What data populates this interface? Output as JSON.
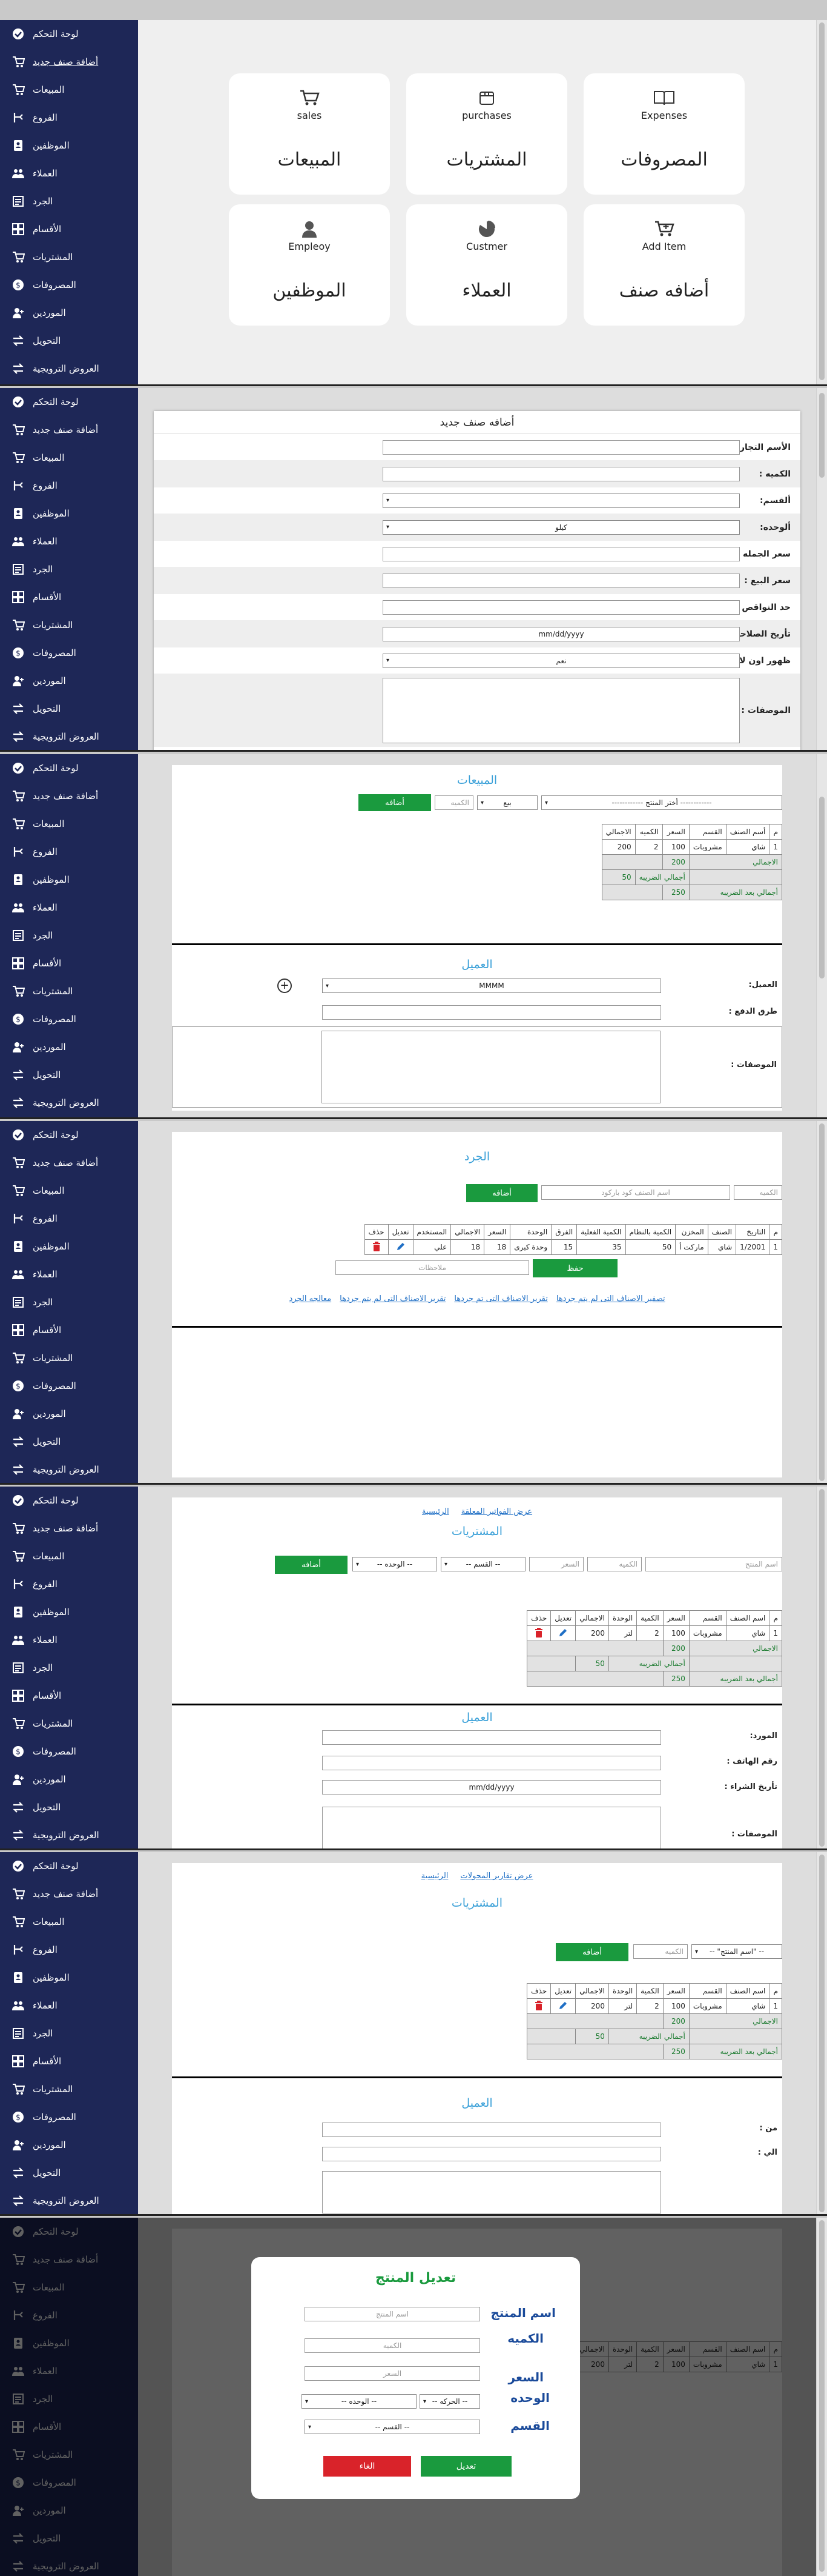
{
  "sidebar": {
    "items": [
      {
        "label": "لوحة التحكم",
        "icon": "dashboard-icon"
      },
      {
        "label": "أضافة صنف جديد",
        "icon": "add-item-icon"
      },
      {
        "label": "المبيعات",
        "icon": "cart-icon"
      },
      {
        "label": "الفروع",
        "icon": "branch-icon"
      },
      {
        "label": "الموظفين",
        "icon": "employee-icon"
      },
      {
        "label": "العملاء",
        "icon": "customers-icon"
      },
      {
        "label": "الجرد",
        "icon": "inventory-icon"
      },
      {
        "label": "الأقسام",
        "icon": "departments-icon"
      },
      {
        "label": "المشتريات",
        "icon": "cart-icon"
      },
      {
        "label": "المصروفات",
        "icon": "expenses-icon"
      },
      {
        "label": "الموردين",
        "icon": "suppliers-icon"
      },
      {
        "label": "التحويل",
        "icon": "transfer-icon"
      },
      {
        "label": "العروض الترويجية",
        "icon": "offers-icon"
      }
    ]
  },
  "dashboard": {
    "cards": [
      {
        "en": "Expenses",
        "ar": "المصروفات",
        "icon": "book-icon"
      },
      {
        "en": "purchases",
        "ar": "المشتريات",
        "icon": "box-icon"
      },
      {
        "en": "sales",
        "ar": "المبيعات",
        "icon": "cart-icon"
      },
      {
        "en": "Add Item",
        "ar": "أضافه صنف",
        "icon": "cart-plus-icon"
      },
      {
        "en": "Custmer",
        "ar": "العملاء",
        "icon": "pie-icon"
      },
      {
        "en": "Empleoy",
        "ar": "الموظفين",
        "icon": "user-icon"
      }
    ]
  },
  "add_item": {
    "title": "أضافه صنف جديد",
    "fields": [
      {
        "label": "الأسم التجاري:",
        "type": "text",
        "value": ""
      },
      {
        "label": "الكميه :",
        "type": "text",
        "value": ""
      },
      {
        "label": "ألقسم:",
        "type": "select",
        "value": ""
      },
      {
        "label": "ألوحده:",
        "type": "select",
        "value": "كيلو"
      },
      {
        "label": "سعر الجمله :",
        "type": "text",
        "value": ""
      },
      {
        "label": "سعر البيع :",
        "type": "text",
        "value": ""
      },
      {
        "label": "حد النواقص :",
        "type": "text",
        "value": ""
      },
      {
        "label": "تأريخ الصلاحيه :",
        "type": "date",
        "value": "mm/dd/yyyy"
      },
      {
        "label": "ظهور اون لاين:",
        "type": "select",
        "value": "نعم"
      },
      {
        "label": "الموصفات :",
        "type": "textarea",
        "value": ""
      }
    ]
  },
  "sales": {
    "title": "المبيعات",
    "product_select": "------------ أختر المنتج ------------",
    "type_select": "بيع",
    "qty_placeholder": "الكميه",
    "add_label": "أضافه",
    "headers": [
      "م",
      "أسم الصنف",
      "القسم",
      "السعر",
      "الكميه",
      "الاجمالي"
    ],
    "rows": [
      [
        "1",
        "شاي",
        "مشروبات",
        "100",
        "2",
        "200"
      ]
    ],
    "total_label": "الاجمالي",
    "total_value": "200",
    "tax_label": "أجمالي الضريبه",
    "tax_value": "50",
    "after_tax_label": "أجمالي بعد الضريبه",
    "after_tax_value": "250",
    "client_title": "العميل",
    "client_label": "العميل:",
    "client_value": "MMMM",
    "payment_label": "طرق الدفع :",
    "notes_label": "الموصفات :"
  },
  "inventory": {
    "title": "الجرد",
    "qty_placeholder": "الكميه",
    "search_placeholder": "اسم الصنف كود باركود",
    "add_label": "أضافه",
    "headers": [
      "م",
      "التاريخ",
      "الصنف",
      "المخزن",
      "الكمية بالنظام",
      "الكمية الفعلية",
      "الفرق",
      "الوحدة",
      "السعر",
      "الاجمالي",
      "المستخدم",
      "تعديل",
      "حذف"
    ],
    "rows": [
      [
        "1",
        "1/2001",
        "شاي",
        "ماركت أ",
        "50",
        "35",
        "15",
        "وحدة كبرى",
        "18",
        "18",
        "علي"
      ]
    ],
    "notes_placeholder": "ملاحظات",
    "save_label": "حفظ",
    "links": [
      "تصفير الاصناف التى لم يتم جردها",
      "تقرير الاصناف التى تم جردها",
      "تقرير الاصناف التى لم يتم جردها",
      "معالجه الجرد"
    ]
  },
  "purchases": {
    "top_links": [
      "عرض الفواتير المعلقة",
      "الرئيسية"
    ],
    "title": "المشتريات",
    "name_placeholder": "اسم المنتج",
    "qty_placeholder": "الكميه",
    "price_placeholder": "السعر",
    "dept_select": "-- القسم --",
    "unit_select": "-- الوحده --",
    "add_label": "أضافه",
    "headers": [
      "م",
      "اسم الصنف",
      "القسم",
      "السعر",
      "الكمية",
      "الوحدة",
      "الاجمالي",
      "تعديل",
      "حذف"
    ],
    "rows": [
      [
        "1",
        "شاي",
        "مشروبات",
        "100",
        "2",
        "لتر",
        "200"
      ]
    ],
    "total_label": "الاجمالي",
    "total_value": "200",
    "tax_label": "أجمالي الضريبه",
    "tax_value": "50",
    "after_tax_label": "أجمالي بعد الضريبه",
    "after_tax_value": "250",
    "client_title": "العميل",
    "supplier_label": "المورد:",
    "phone_label": "رقم الهاتف :",
    "date_label": "تأريخ الشراء :",
    "date_value": "mm/dd/yyyy",
    "notes_label": "الموصفات :"
  },
  "purchases2": {
    "top_links": [
      "عرض تقارير المحولات",
      "الرئيسية"
    ],
    "title": "المشتريات",
    "product_select": "-- \"اسم المنتج\" --",
    "qty_placeholder": "الكميه",
    "add_label": "أضافه",
    "from_label": "من :",
    "to_label": "الي :"
  },
  "modal": {
    "title": "تعديل المنتج",
    "name_label": "اسم المنتج",
    "name_placeholder": "اسم المنتج",
    "qty_label": "الكميه",
    "qty_placeholder": "الكميه",
    "price_label": "السعر",
    "price_placeholder": "السعر",
    "unit_label": "الوحده",
    "unit_select1": "-- الوحده --",
    "unit_select2": "-- الحركه --",
    "dept_label": "القسم",
    "dept_select": "-- القسم --",
    "edit_label": "تعديل",
    "cancel_label": "الغاء"
  },
  "colors": {
    "sidebar": "#1e2757",
    "green": "#1a9a3e",
    "blue": "#3aa0d8",
    "red": "#d9232a"
  }
}
